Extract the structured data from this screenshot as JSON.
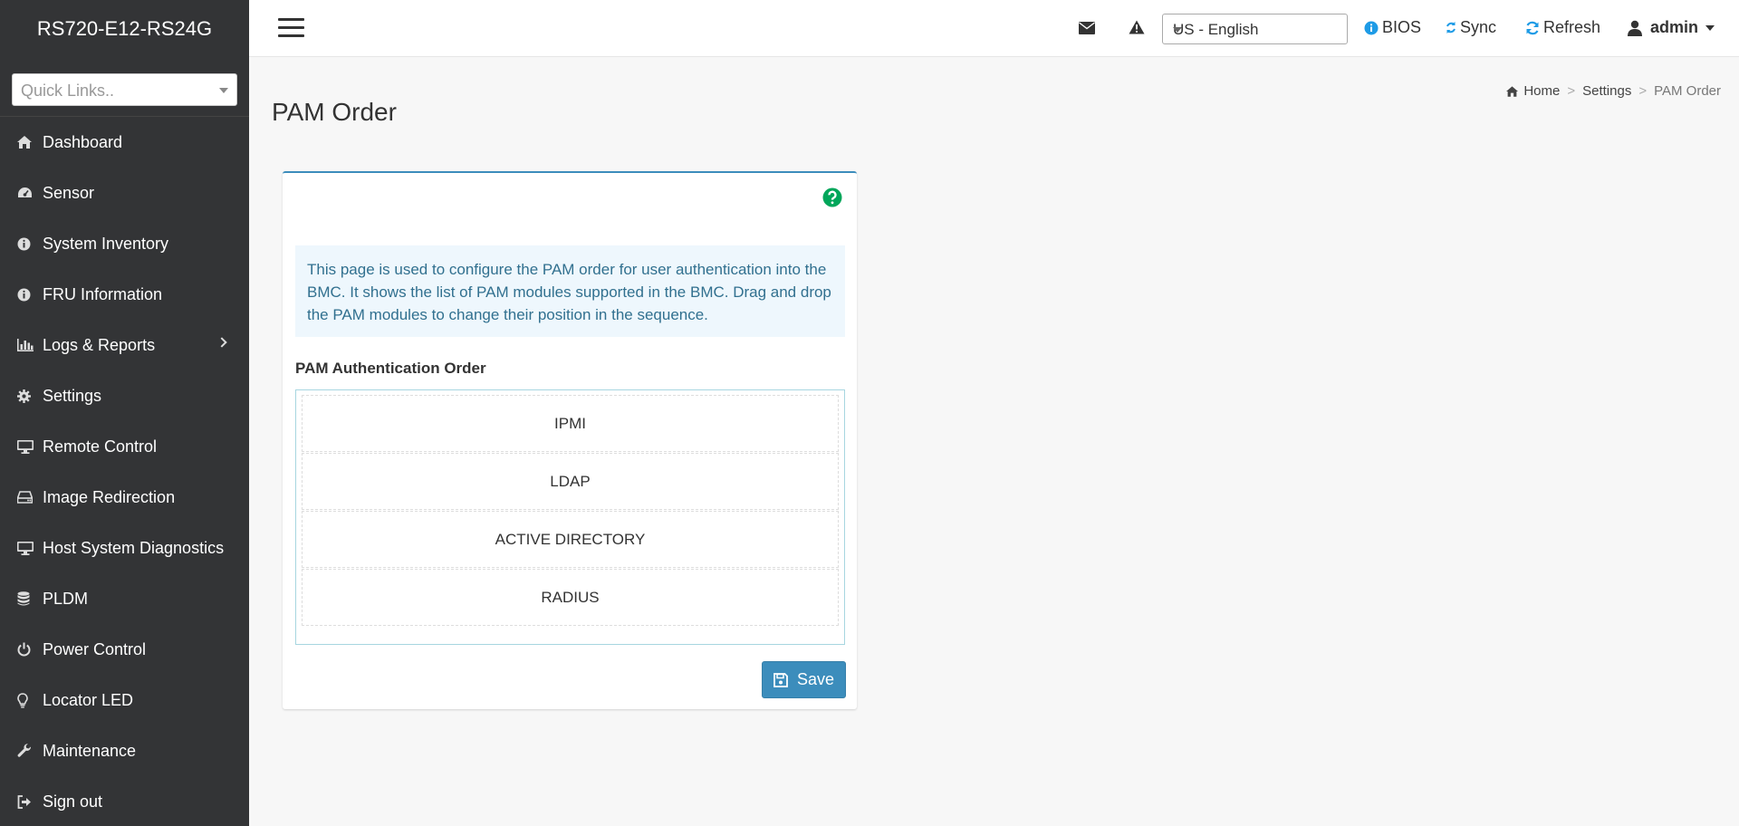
{
  "brand": "RS720-E12-RS24G",
  "quick_links": {
    "placeholder": "Quick Links.."
  },
  "sidebar": {
    "items": [
      {
        "label": "Dashboard",
        "icon": "home-icon"
      },
      {
        "label": "Sensor",
        "icon": "dashboard-icon"
      },
      {
        "label": "System Inventory",
        "icon": "info-icon"
      },
      {
        "label": "FRU Information",
        "icon": "info-icon"
      },
      {
        "label": "Logs & Reports",
        "icon": "bar-chart-icon",
        "has_submenu": true
      },
      {
        "label": "Settings",
        "icon": "gear-icon"
      },
      {
        "label": "Remote Control",
        "icon": "desktop-icon"
      },
      {
        "label": "Image Redirection",
        "icon": "hdd-icon"
      },
      {
        "label": "Host System Diagnostics",
        "icon": "desktop-icon"
      },
      {
        "label": "PLDM",
        "icon": "database-icon"
      },
      {
        "label": "Power Control",
        "icon": "power-icon"
      },
      {
        "label": "Locator LED",
        "icon": "lightbulb-icon"
      },
      {
        "label": "Maintenance",
        "icon": "wrench-icon"
      },
      {
        "label": "Sign out",
        "icon": "sign-out-icon"
      }
    ]
  },
  "header": {
    "language": "US - English",
    "bios": "BIOS",
    "sync": "Sync",
    "refresh": "Refresh",
    "user": "admin"
  },
  "page": {
    "title": "PAM Order",
    "breadcrumb": {
      "home": "Home",
      "settings": "Settings",
      "current": "PAM Order"
    },
    "description": "This page is used to configure the PAM order for user authentication into the BMC. It shows the list of PAM modules supported in the BMC. Drag and drop the PAM modules to change their position in the sequence.",
    "section_title": "PAM Authentication Order",
    "modules": [
      "IPMI",
      "LDAP",
      "ACTIVE DIRECTORY",
      "RADIUS"
    ],
    "save_label": "Save"
  },
  "colors": {
    "sidebar_bg": "#333436",
    "accent": "#3c8dbc",
    "help": "#00a65a",
    "callout_bg": "#eef7fd"
  }
}
